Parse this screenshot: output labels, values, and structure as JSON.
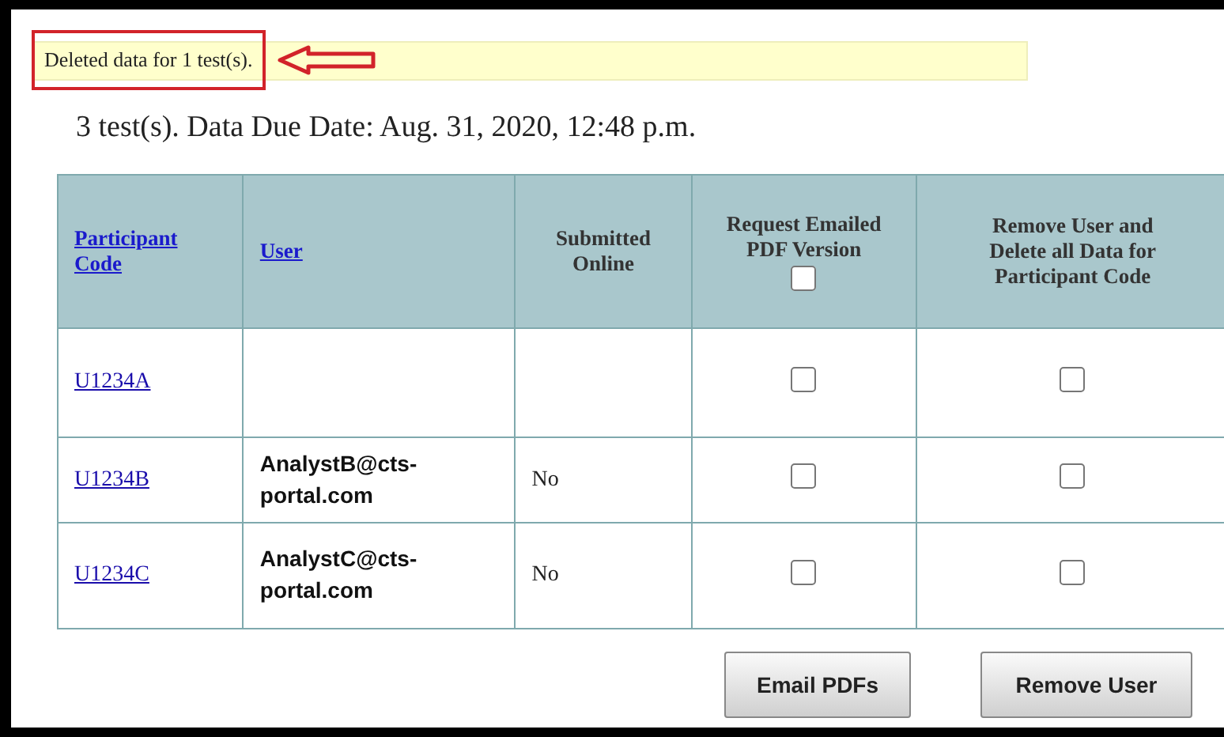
{
  "message": {
    "text": "Deleted data for 1 test(s).",
    "highlighted": true
  },
  "summary": "3 test(s). Data Due Date: Aug. 31, 2020, 12:48 p.m.",
  "table": {
    "columns": [
      {
        "label": "Participant Code",
        "kind": "link"
      },
      {
        "label": "User",
        "kind": "link"
      },
      {
        "label": "Submitted Online",
        "kind": "text"
      },
      {
        "label": "Request Emailed PDF Version",
        "kind": "checkbox",
        "checked": false
      },
      {
        "label": "Remove User and Delete all Data for Participant Code",
        "kind": "text"
      }
    ],
    "rows": [
      {
        "participant_code": "U1234A",
        "request_pdf": {
          "checked": false
        },
        "remove": {
          "checked": false
        }
      },
      {
        "participant_code": "U1234B",
        "user": "AnalystB@cts-portal.com",
        "submitted_online": "No",
        "request_pdf": {
          "checked": false
        },
        "remove": {
          "checked": false
        }
      },
      {
        "participant_code": "U1234C",
        "user": "AnalystC@cts-portal.com",
        "submitted_online": "No",
        "request_pdf": {
          "checked": false
        },
        "remove": {
          "checked": false
        }
      }
    ]
  },
  "buttons": [
    "Email PDFs",
    "Remove User"
  ]
}
